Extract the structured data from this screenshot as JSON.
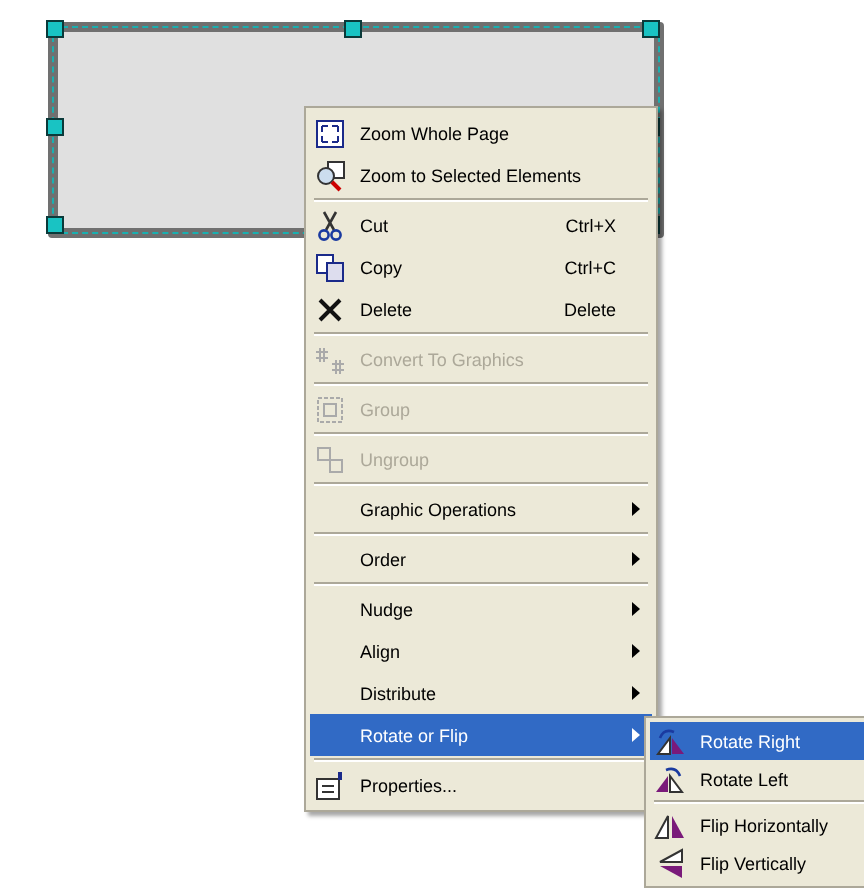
{
  "canvas": {
    "shape": {
      "kind": "rectangle",
      "selected": true
    }
  },
  "context_menu": {
    "items": [
      {
        "kind": "item",
        "label": "Zoom Whole Page",
        "disabled": false,
        "has_submenu": false,
        "selected": false
      },
      {
        "kind": "item",
        "label": "Zoom to Selected Elements",
        "disabled": false,
        "has_submenu": false,
        "selected": false
      },
      {
        "kind": "separator"
      },
      {
        "kind": "item",
        "label": "Cut",
        "shortcut": "Ctrl+X",
        "disabled": false,
        "has_submenu": false,
        "selected": false
      },
      {
        "kind": "item",
        "label": "Copy",
        "shortcut": "Ctrl+C",
        "disabled": false,
        "has_submenu": false,
        "selected": false
      },
      {
        "kind": "item",
        "label": "Delete",
        "shortcut": "Delete",
        "disabled": false,
        "has_submenu": false,
        "selected": false
      },
      {
        "kind": "separator"
      },
      {
        "kind": "item",
        "label": "Convert To Graphics",
        "disabled": true,
        "has_submenu": false,
        "selected": false
      },
      {
        "kind": "separator"
      },
      {
        "kind": "item",
        "label": "Group",
        "disabled": true,
        "has_submenu": false,
        "selected": false
      },
      {
        "kind": "separator"
      },
      {
        "kind": "item",
        "label": "Ungroup",
        "disabled": true,
        "has_submenu": false,
        "selected": false
      },
      {
        "kind": "separator"
      },
      {
        "kind": "item",
        "label": "Graphic Operations",
        "disabled": false,
        "has_submenu": true,
        "selected": false
      },
      {
        "kind": "separator"
      },
      {
        "kind": "item",
        "label": "Order",
        "disabled": false,
        "has_submenu": true,
        "selected": false
      },
      {
        "kind": "separator"
      },
      {
        "kind": "item",
        "label": "Nudge",
        "disabled": false,
        "has_submenu": true,
        "selected": false
      },
      {
        "kind": "item",
        "label": "Align",
        "disabled": false,
        "has_submenu": true,
        "selected": false
      },
      {
        "kind": "item",
        "label": "Distribute",
        "disabled": false,
        "has_submenu": true,
        "selected": false
      },
      {
        "kind": "item",
        "label": "Rotate or Flip",
        "disabled": false,
        "has_submenu": true,
        "selected": true
      },
      {
        "kind": "separator"
      },
      {
        "kind": "item",
        "label": "Properties...",
        "disabled": false,
        "has_submenu": false,
        "selected": false
      }
    ]
  },
  "submenu": {
    "items": [
      {
        "kind": "item",
        "label": "Rotate Right",
        "disabled": false,
        "selected": true
      },
      {
        "kind": "item",
        "label": "Rotate Left",
        "disabled": false,
        "selected": false
      },
      {
        "kind": "separator"
      },
      {
        "kind": "item",
        "label": "Flip Horizontally",
        "disabled": false,
        "selected": false
      },
      {
        "kind": "item",
        "label": "Flip Vertically",
        "disabled": false,
        "selected": false
      }
    ]
  }
}
